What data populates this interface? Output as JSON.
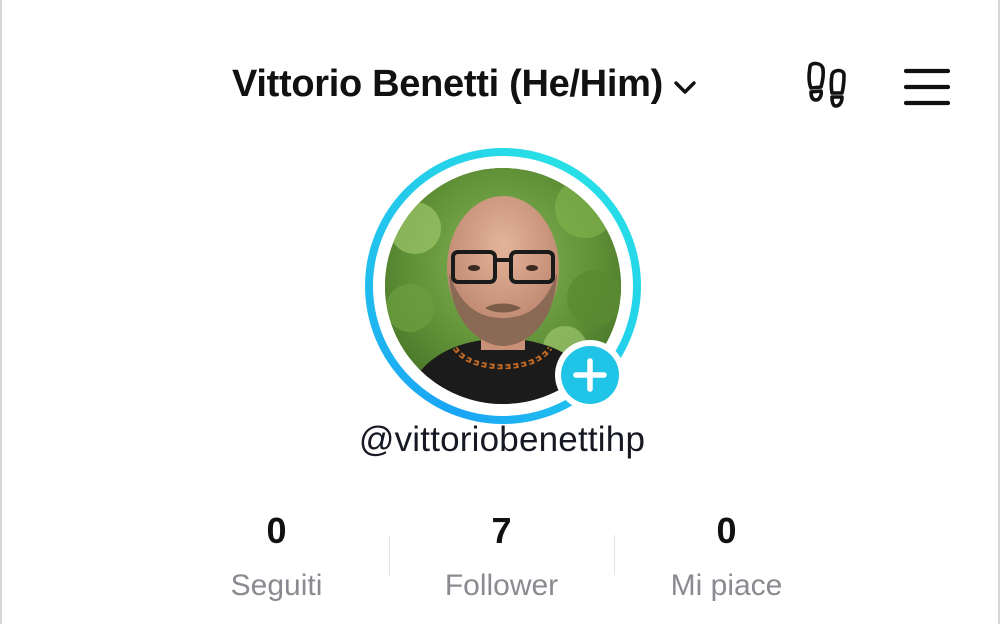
{
  "header": {
    "profile_name": "Vittorio Benetti (He/Him)",
    "icons": [
      "chevron-down-icon",
      "footprint-icon",
      "hamburger-menu-icon"
    ]
  },
  "profile": {
    "username": "@vittoriobenettihp",
    "avatar_ring_colors": [
      "#1aa4f5",
      "#28e0e6"
    ],
    "add_story_color": "#20c4e6"
  },
  "stats": [
    {
      "value": "0",
      "label": "Seguiti"
    },
    {
      "value": "7",
      "label": "Follower"
    },
    {
      "value": "0",
      "label": "Mi piace"
    }
  ]
}
